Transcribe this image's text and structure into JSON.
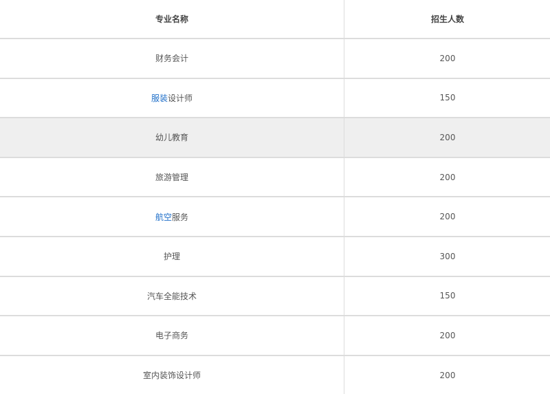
{
  "headers": {
    "name": "专业名称",
    "count": "招生人数"
  },
  "rows": [
    {
      "link": "",
      "rest": "财务会计",
      "count": "200"
    },
    {
      "link": "服装",
      "rest": "设计师",
      "count": "150"
    },
    {
      "link": "",
      "rest": "幼儿教育",
      "count": "200"
    },
    {
      "link": "",
      "rest": "旅游管理",
      "count": "200"
    },
    {
      "link": "航空",
      "rest": "服务",
      "count": "200"
    },
    {
      "link": "",
      "rest": "护理",
      "count": "300"
    },
    {
      "link": "",
      "rest": "汽车全能技术",
      "count": "150"
    },
    {
      "link": "",
      "rest": "电子商务",
      "count": "200"
    },
    {
      "link": "",
      "rest": "室内装饰设计师",
      "count": "200"
    }
  ],
  "colors": {
    "link": "#1f6fc9",
    "highlight_row_bg": "#efefef",
    "border": "#dcdcdc"
  }
}
